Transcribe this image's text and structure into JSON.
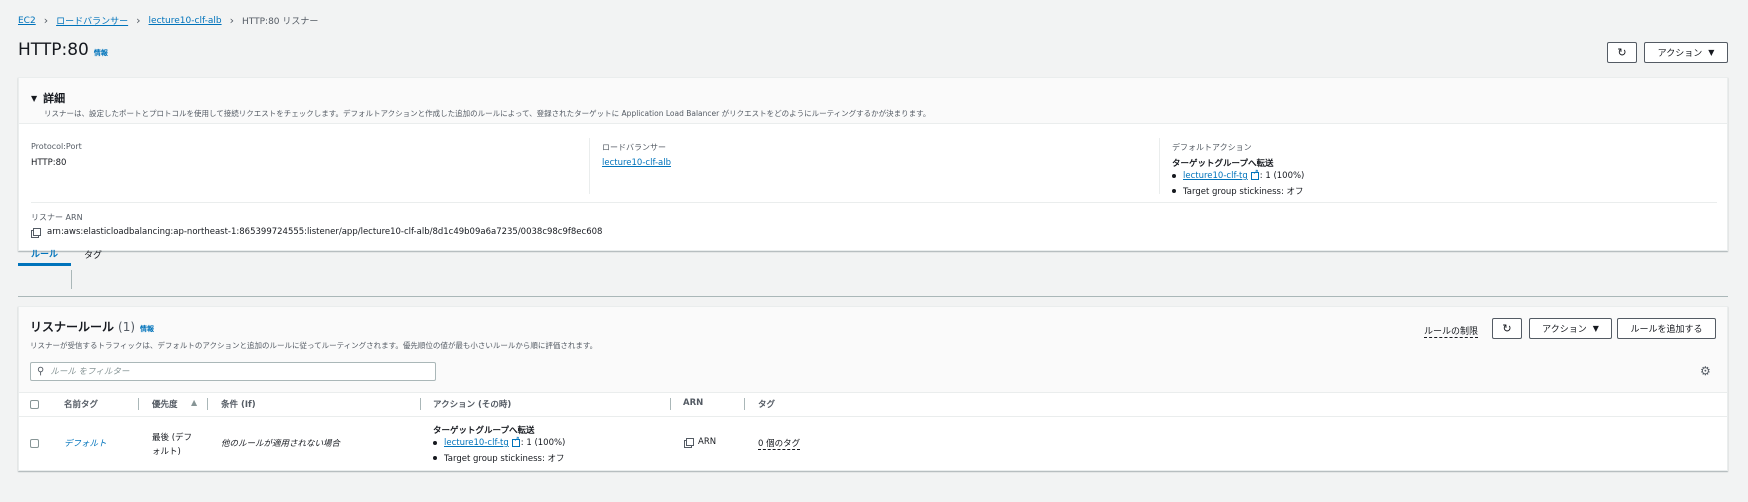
{
  "breadcrumb": {
    "ec2": "EC2",
    "load_balancers": "ロードバランサー",
    "alb": "lecture10-clf-alb",
    "current": "HTTP:80 リスナー"
  },
  "header": {
    "title": "HTTP:80",
    "info": "情報",
    "actions_label": "アクション"
  },
  "details": {
    "title": "詳細",
    "description": "リスナーは、設定したポートとプロトコルを使用して接続リクエストをチェックします。デフォルトアクションと作成した追加のルールによって、登録されたターゲットに Application Load Balancer がリクエストをどのようにルーティングするかが決まります。",
    "protocol_port_label": "Protocol:Port",
    "protocol_port_value": "HTTP:80",
    "lb_label": "ロードバランサー",
    "lb_value": "lecture10-clf-alb",
    "default_action_label": "デフォルトアクション",
    "default_action_title": "ターゲットグループへ転送",
    "target_group": "lecture10-clf-tg",
    "target_group_weight": ": 1 (100%)",
    "stickiness": "Target group stickiness: オフ",
    "arn_label": "リスナー ARN",
    "arn_value": "arn:aws:elasticloadbalancing:ap-northeast-1:865399724555:listener/app/lecture10-clf-alb/8d1c49b09a6a7235/0038c98c9f8ec608"
  },
  "tabs": [
    "ルール",
    "タグ"
  ],
  "rules": {
    "title": "リスナールール",
    "count": "(1)",
    "info": "情報",
    "description": "リスナーが受信するトラフィックは、デフォルトのアクションと追加のルールに従ってルーティングされます。優先順位の値が最も小さいルールから順に評価されます。",
    "limits_label": "ルールの制限",
    "actions_label": "アクション",
    "add_rule_label": "ルールを追加する",
    "filter_placeholder": "ルール をフィルター",
    "columns": [
      "名前タグ",
      "優先度",
      "条件 (If)",
      "アクション (その時)",
      "ARN",
      "タグ"
    ],
    "rows": [
      {
        "name": "デフォルト",
        "priority": "最後 (デフォルト)",
        "priority_line1": "最後 (デフ",
        "priority_line2": "ォルト)",
        "condition": "他のルールが適用されない場合",
        "action_title": "ターゲットグループへ転送",
        "target_group": "lecture10-clf-tg",
        "target_group_weight": ": 1 (100%)",
        "stickiness": "Target group stickiness: オフ",
        "arn": "ARN",
        "tags": "0 個のタグ"
      }
    ]
  }
}
